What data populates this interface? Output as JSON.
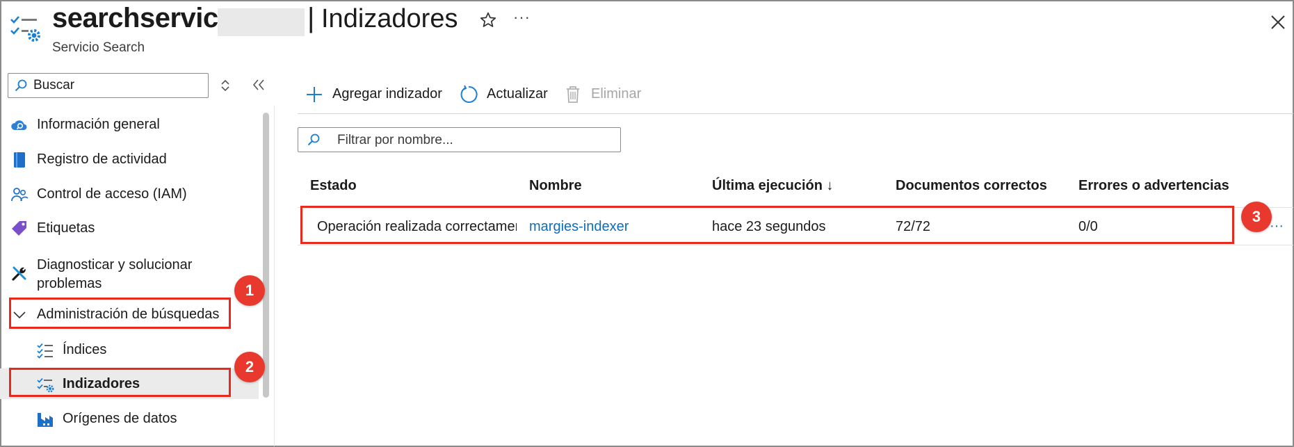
{
  "header": {
    "title_prefix": "searchservice-",
    "separator": "|",
    "page_title": "Indizadores",
    "subtitle": "Servicio Search",
    "favorite_icon": "star-icon",
    "more_label": "···",
    "close_icon": "close-icon"
  },
  "sidebar": {
    "search_placeholder": "Buscar",
    "items": [
      {
        "label": "Información general",
        "icon": "cloud-search-icon"
      },
      {
        "label": "Registro de actividad",
        "icon": "activity-log-icon"
      },
      {
        "label": "Control de acceso (IAM)",
        "icon": "users-icon"
      },
      {
        "label": "Etiquetas",
        "icon": "tag-icon"
      },
      {
        "label": "Diagnosticar y solucionar problemas",
        "icon": "wrench-icon"
      },
      {
        "label": "Administración de búsquedas",
        "icon": "chevron-down-icon"
      },
      {
        "label": "Índices",
        "icon": "index-list-icon"
      },
      {
        "label": "Indizadores",
        "icon": "indexer-icon",
        "selected": true
      },
      {
        "label": "Orígenes de datos",
        "icon": "data-source-icon"
      }
    ]
  },
  "toolbar": {
    "add_label": "Agregar indizador",
    "refresh_label": "Actualizar",
    "delete_label": "Eliminar"
  },
  "filter": {
    "placeholder": "Filtrar por nombre..."
  },
  "table": {
    "columns": [
      "Estado",
      "Nombre",
      "Última ejecución ↓",
      "Documentos correctos",
      "Errores o advertencias"
    ],
    "rows": [
      {
        "status": "Operación realizada correctamente",
        "name": "margies-indexer",
        "last_run": "hace 23 segundos",
        "docs_ok": "72/72",
        "errors": "0/0",
        "more": "···"
      }
    ]
  },
  "annotations": [
    "1",
    "2",
    "3"
  ],
  "colors": {
    "accent": "#0f6cbd",
    "callout": "#e8291c",
    "selected_bg": "#ebebeb"
  }
}
